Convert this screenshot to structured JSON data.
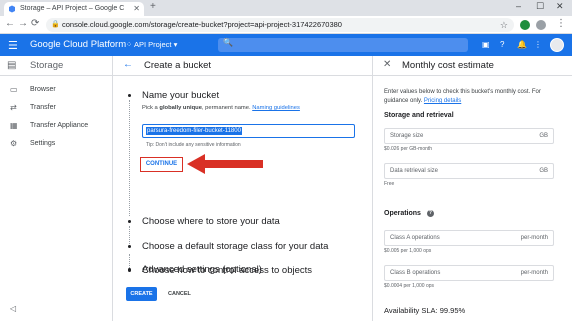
{
  "browser": {
    "tab_title": "Storage – API Project – Google C",
    "url": "console.cloud.google.com/storage/create-bucket?project=api-project-317422670380"
  },
  "header": {
    "brand": "Google Cloud Platform",
    "project": "API Project"
  },
  "sidebar": {
    "title": "Storage",
    "items": [
      {
        "label": "Browser",
        "icon": "bucket-icon"
      },
      {
        "label": "Transfer",
        "icon": "transfer-icon"
      },
      {
        "label": "Transfer Appliance",
        "icon": "appliance-icon"
      },
      {
        "label": "Settings",
        "icon": "gear-icon"
      }
    ]
  },
  "main": {
    "title": "Create a bucket",
    "step1_title": "Name your bucket",
    "desc_prefix": "Pick a ",
    "desc_bold": "globally unique",
    "desc_suffix": ", permanent name. ",
    "desc_link": "Naming guidelines",
    "bucket_name": "parsura-freedom-filer-bucket-11800",
    "tip": "Tip: Don't include any sensitive information",
    "continue_label": "CONTINUE",
    "steps": [
      "Choose where to store your data",
      "Choose a default storage class for your data",
      "Choose how to control access to objects",
      "Advanced settings (optional)"
    ],
    "create_label": "CREATE",
    "cancel_label": "CANCEL"
  },
  "cost_panel": {
    "title": "Monthly cost estimate",
    "intro": "Enter values below to check this bucket's monthly cost. For guidance only. ",
    "intro_link": "Pricing details",
    "storage_section": "Storage and retrieval",
    "storage_size_placeholder": "Storage size",
    "storage_size_unit": "GB",
    "storage_size_sub": "$0.026 per GB-month",
    "retrieval_placeholder": "Data retrieval size",
    "retrieval_unit": "GB",
    "retrieval_sub": "Free",
    "operations_section": "Operations",
    "class_a_placeholder": "Class A operations",
    "class_a_unit": "per-month",
    "class_a_sub": "$0.005 per 1,000 ops",
    "class_b_placeholder": "Class B operations",
    "class_b_unit": "per-month",
    "class_b_sub": "$0.0004 per 1,000 ops",
    "sla": "Availability SLA: 99.95%"
  },
  "colors": {
    "primary": "#1a73e8",
    "annotation_red": "#d93025"
  }
}
